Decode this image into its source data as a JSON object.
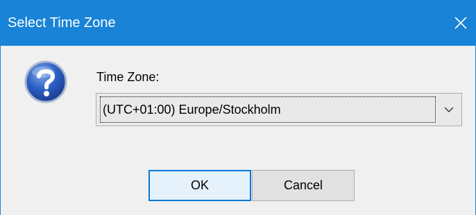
{
  "window": {
    "title": "Select Time Zone",
    "close_icon": "close-icon"
  },
  "dialog": {
    "icon": "question-mark-icon",
    "label": "Time Zone:",
    "timezone_value": "(UTC+01:00) Europe/Stockholm",
    "dropdown_icon": "chevron-down-icon"
  },
  "buttons": {
    "ok_label": "OK",
    "cancel_label": "Cancel"
  },
  "colors": {
    "titlebar": "#1883d7",
    "window_bg": "#f0f0f0",
    "ok_border": "#0078d7"
  }
}
